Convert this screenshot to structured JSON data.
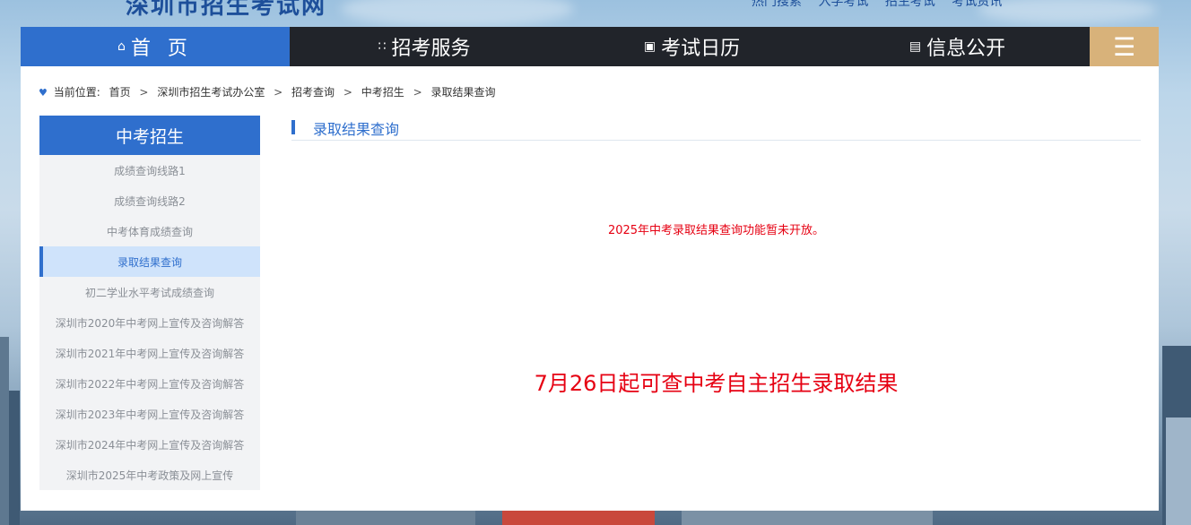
{
  "header": {
    "site_title": "深圳市招生考试网",
    "top_links": [
      "热门搜索",
      "入学考试",
      "招生考试",
      "考试资讯"
    ]
  },
  "nav": {
    "items": [
      {
        "label": "首 页",
        "icon": "home-icon"
      },
      {
        "label": "招考服务",
        "icon": "grid-icon"
      },
      {
        "label": "考试日历",
        "icon": "calendar-icon"
      },
      {
        "label": "信息公开",
        "icon": "document-icon"
      }
    ],
    "menu_icon": "menu-icon"
  },
  "breadcrumb": {
    "prefix": "当前位置:",
    "items": [
      "首页",
      "深圳市招生考试办公室",
      "招考查询",
      "中考招生",
      "录取结果查询"
    ],
    "separator": ">"
  },
  "sidebar": {
    "title": "中考招生",
    "items": [
      {
        "label": "成绩查询线路1",
        "active": false
      },
      {
        "label": "成绩查询线路2",
        "active": false
      },
      {
        "label": "中考体育成绩查询",
        "active": false
      },
      {
        "label": "录取结果查询",
        "active": true
      },
      {
        "label": "初二学业水平考试成绩查询",
        "active": false
      },
      {
        "label": "深圳市2020年中考网上宣传及咨询解答",
        "active": false
      },
      {
        "label": "深圳市2021年中考网上宣传及咨询解答",
        "active": false
      },
      {
        "label": "深圳市2022年中考网上宣传及咨询解答",
        "active": false
      },
      {
        "label": "深圳市2023年中考网上宣传及咨询解答",
        "active": false
      },
      {
        "label": "深圳市2024年中考网上宣传及咨询解答",
        "active": false
      },
      {
        "label": "深圳市2025年中考政策及网上宣传",
        "active": false
      }
    ]
  },
  "content": {
    "title": "录取结果查询",
    "notice_small": "2025年中考录取结果查询功能暂未开放。",
    "notice_big": "7月26日起可查中考自主招生录取结果"
  },
  "colors": {
    "accent": "#2f6fcd",
    "nav_dark": "#21242a",
    "menu_gold": "#d8b27a",
    "notice_red": "#e60012"
  }
}
